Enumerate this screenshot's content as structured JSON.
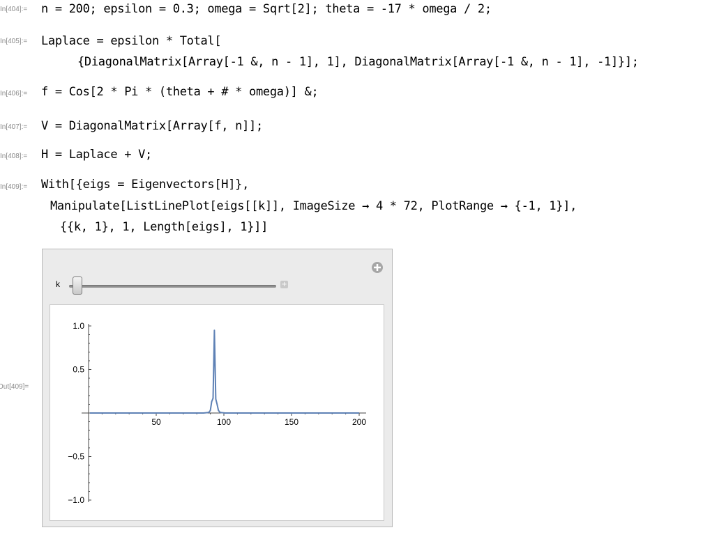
{
  "cells": [
    {
      "label": "In[404]:=",
      "lines": [
        "n = 200; epsilon = 0.3; omega = Sqrt[2]; theta = -17 * omega / 2;"
      ]
    },
    {
      "label": "In[405]:=",
      "lines": [
        "Laplace = epsilon * Total[",
        "{DiagonalMatrix[Array[-1 &, n - 1], 1], DiagonalMatrix[Array[-1 &, n - 1], -1]}];"
      ]
    },
    {
      "label": "In[406]:=",
      "lines": [
        "f = Cos[2 * Pi * (theta + # * omega)] &;"
      ]
    },
    {
      "label": "In[407]:=",
      "lines": [
        "V = DiagonalMatrix[Array[f, n]];"
      ]
    },
    {
      "label": "In[408]:=",
      "lines": [
        "H = Laplace + V;"
      ]
    },
    {
      "label": "In[409]:=",
      "lines": [
        "With[{eigs = Eigenvectors[H]},",
        "Manipulate[ListLinePlot[eigs[[k]], ImageSize → 4 * 72, PlotRange → {-1, 1}],",
        "{{k, 1}, 1, Length[eigs], 1}]]"
      ]
    }
  ],
  "output_label": "Out[409]=",
  "manipulate": {
    "control_label": "k",
    "slider_value": 1,
    "slider_min": 1,
    "slider_max": 200,
    "plus_icon": "add-circle-icon",
    "expand_icon": "slider-expand-icon"
  },
  "chart_data": {
    "type": "line",
    "title": "",
    "xlabel": "",
    "ylabel": "",
    "xlim": [
      0,
      200
    ],
    "ylim": [
      -1,
      1
    ],
    "xticks": [
      {
        "value": 50,
        "label": "50"
      },
      {
        "value": 100,
        "label": "100"
      },
      {
        "value": 150,
        "label": "150"
      },
      {
        "value": 200,
        "label": "200"
      }
    ],
    "yticks": [
      {
        "value": 1,
        "label": "1.0"
      },
      {
        "value": 0.5,
        "label": "0.5"
      },
      {
        "value": -0.5,
        "label": "−0.5"
      },
      {
        "value": -1,
        "label": "−1.0"
      }
    ],
    "series": [
      {
        "color": "#5e81b5",
        "x": [
          1,
          85,
          88,
          89,
          90,
          91,
          92,
          93,
          94,
          95,
          96,
          97,
          98,
          101,
          200
        ],
        "values": [
          0,
          0,
          0.005,
          0.01,
          0.03,
          0.13,
          0.17,
          0.95,
          0.16,
          0.1,
          0.03,
          0.01,
          0.005,
          0,
          0
        ]
      }
    ]
  }
}
